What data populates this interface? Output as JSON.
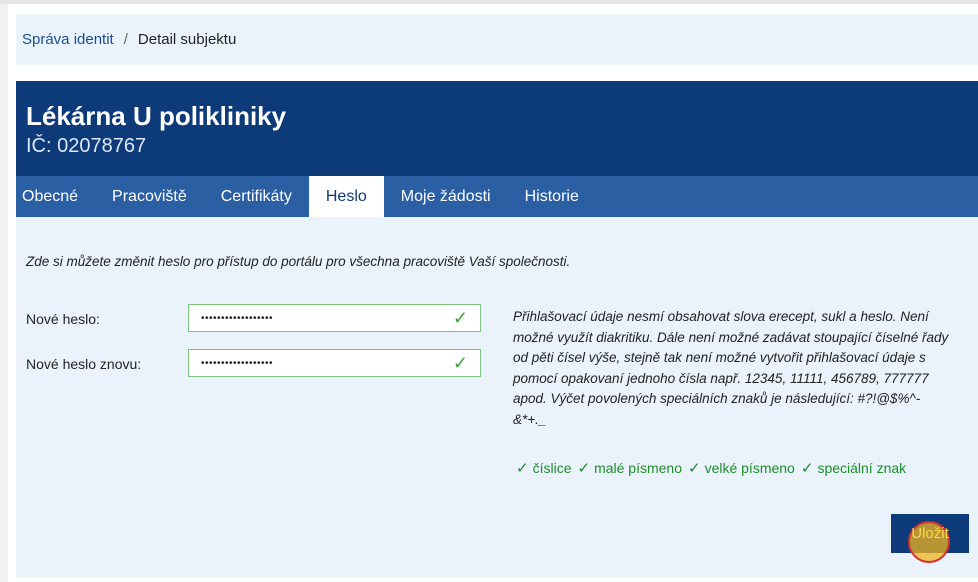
{
  "breadcrumb": {
    "parent": "Správa identit",
    "separator": "/",
    "current": "Detail subjektu"
  },
  "header": {
    "title": "Lékárna U polikliniky",
    "ico": "IČ: 02078767"
  },
  "tabs": [
    {
      "label": "Obecné"
    },
    {
      "label": "Pracoviště"
    },
    {
      "label": "Certifikáty"
    },
    {
      "label": "Heslo"
    },
    {
      "label": "Moje žádosti"
    },
    {
      "label": "Historie"
    }
  ],
  "form": {
    "intro": "Zde si můžete změnit heslo pro přístup do portálu pro všechna pracoviště Vaší společnosti.",
    "new_password_label": "Nové heslo:",
    "new_password_value": "••••••••••••••••••",
    "repeat_password_label": "Nové heslo znovu:",
    "repeat_password_value": "••••••••••••••••••",
    "help_text": "Přihlašovací údaje nesmí obsahovat slova erecept, sukl a heslo. Není možné využít diakritiku. Dále není možné zadávat stoupající číselné řady od pěti čísel výše, stejně tak není možné vytvořit přihlašovací údaje s pomocí opakovaní jednoho čísla např. 12345, 11111, 456789, 777777 apod. Výčet povolených speciálních znaků je následující: #?!@$%^-&*+._",
    "requirements": [
      {
        "label": "číslice"
      },
      {
        "label": "malé písmeno"
      },
      {
        "label": "velké písmeno"
      },
      {
        "label": "speciální znak"
      }
    ],
    "save_label": "Uložit"
  },
  "colors": {
    "header_bg": "#0d3a78",
    "tab_bar": "#2a5fa4",
    "content_bg": "#eaf3fc",
    "ok_green": "#1f8c2a"
  }
}
